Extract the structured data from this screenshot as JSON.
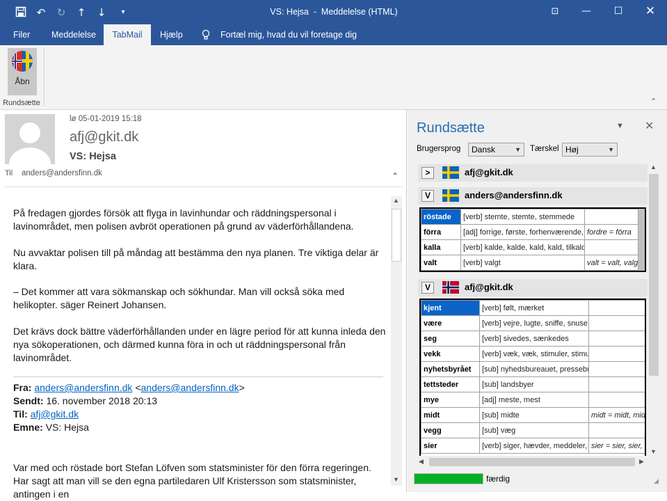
{
  "window": {
    "title": "VS: Hejsa  -  Meddelelse (HTML)"
  },
  "menu": [
    "Filer",
    "Meddelelse",
    "TabMail",
    "Hjælp"
  ],
  "tell_me": "Fortæl mig, hvad du vil foretage dig",
  "ribbon": {
    "button_label": "Åbn",
    "group_label": "Rundsætte"
  },
  "email": {
    "date": "lø 05-01-2019 15:18",
    "sender": "afj@gkit.dk",
    "subject": "VS: Hejsa",
    "to_label": "Til",
    "to": "anders@andersfinn.dk",
    "paragraphs": [
      "På fredagen gjordes försök att flyga in lavinhundar och räddningspersonal i lavinområdet, men polisen avbröt operationen på grund av väderförhållandena.",
      "Nu avvaktar polisen till på måndag att bestämma den nya planen. Tre viktiga delar är klara.",
      "– Det kommer att vara sökmanskap och sökhundar. Man vill också söka med helikopter. säger Reinert Johansen.",
      "Det krävs dock bättre väderförhållanden under en lägre period för att kunna inleda den nya sökoperationen, och därmed kunna föra in och ut räddningspersonal från lavinområdet."
    ],
    "fwd": {
      "from_label": "Fra:",
      "from_link": "anders@andersfinn.dk",
      "from_rest_pre": "<",
      "from_email": "anders@andersfinn.dk",
      "from_rest_post": ">",
      "sent_label": "Sendt:",
      "sent": "16. november 2018 20:13",
      "to_label": "Til:",
      "to": "afj@gkit.dk",
      "subject_label": "Emne:",
      "subject": "VS: Hejsa"
    },
    "last_paragraph": "Var med och röstade bort Stefan Löfven som statsminister för den förra regeringen. Har sagt att man vill se den egna partiledaren Ulf Kristersson som statsminister, antingen i en"
  },
  "addin": {
    "title": "Rundsætte",
    "lang_label": "Brugersprog",
    "lang_value": "Dansk",
    "threshold_label": "Tærskel",
    "threshold_value": "Høj",
    "status": "færdig",
    "progress": 1.0,
    "groups": [
      {
        "toggle": ">",
        "flag": "sweden",
        "sender": "afj@gkit.dk"
      },
      {
        "toggle": "V",
        "flag": "sweden",
        "sender": "anders@andersfinn.dk",
        "rows": [
          {
            "word": "röstade",
            "trans": "[verb] stemte, stemte, stemmede",
            "note": "",
            "selected": true
          },
          {
            "word": "förra",
            "trans": "[adj] forrige, første, forhenværende, fortrængende",
            "note": "fordre = förra"
          },
          {
            "word": "kalla",
            "trans": "[verb] kalde, kalde, kald, kald, tilkalde, indkalde, tilkald",
            "note": ""
          },
          {
            "word": "valt",
            "trans": "[verb] valgt",
            "note": "valt = valt, valg"
          }
        ]
      },
      {
        "toggle": "V",
        "flag": "norway",
        "sender": "afj@gkit.dk",
        "rows": [
          {
            "word": "kjent",
            "trans": "[verb] følt, mærket",
            "note": "",
            "selected": true
          },
          {
            "word": "være",
            "trans": "[verb] vejre, lugte, sniffe, snuse",
            "note": ""
          },
          {
            "word": "seg",
            "trans": "[verb] sivedes, sænkedes",
            "note": ""
          },
          {
            "word": "vekk",
            "trans": "[verb] væk, væk, stimuler, stimuler",
            "note": ""
          },
          {
            "word": "nyhetsbyrået",
            "trans": "[sub] nyhedsbureauet, pressebureauet",
            "note": ""
          },
          {
            "word": "tettsteder",
            "trans": "[sub] landsbyer",
            "note": ""
          },
          {
            "word": "mye",
            "trans": "[adj] meste, mest",
            "note": ""
          },
          {
            "word": "midt",
            "trans": "[sub] midte",
            "note": "midt = midt, midt, midt"
          },
          {
            "word": "vegg",
            "trans": "[sub] væg",
            "note": ""
          },
          {
            "word": "sier",
            "trans": "[verb] siger, hævder, meddeler, fortæller, påstår",
            "note": "sier = sier, sier, sier"
          }
        ]
      }
    ]
  },
  "colors": {
    "accent": "#2b579a",
    "progress": "#06b025",
    "selected": "#0a64c8"
  }
}
